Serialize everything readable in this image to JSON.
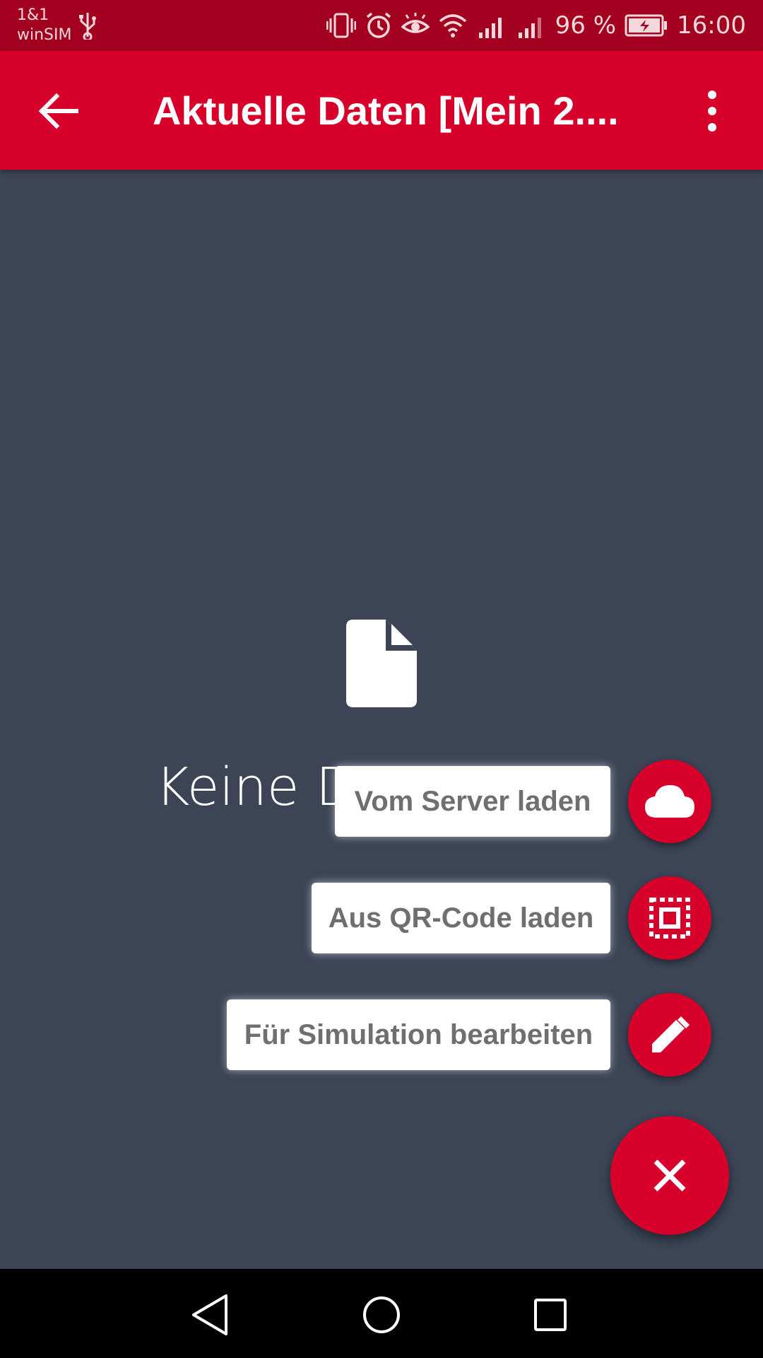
{
  "status_bar": {
    "carrier_line1": "1&1",
    "carrier_line2": "winSIM",
    "battery": "96 %",
    "time": "16:00",
    "icons": [
      "usb-icon",
      "vibrate-icon",
      "alarm-icon",
      "eye-icon",
      "wifi-icon",
      "signal-icon",
      "signal-icon-2",
      "battery-charging-icon"
    ]
  },
  "app_bar": {
    "title": "Aktuelle Daten [Mein 2....",
    "back_icon": "arrow-back-icon",
    "menu_icon": "more-vert-icon",
    "color": "#d6002a"
  },
  "empty_state": {
    "icon": "file-icon",
    "text": "Keine Daten"
  },
  "speed_dial": {
    "actions": [
      {
        "label": "Vom Server laden",
        "icon": "cloud-icon"
      },
      {
        "label": "Aus QR-Code laden",
        "icon": "qr-scan-icon"
      },
      {
        "label": "Für Simulation bearbeiten",
        "icon": "pencil-icon"
      }
    ],
    "close_icon": "close-icon"
  },
  "nav_bar": {
    "icons": [
      "nav-back-icon",
      "nav-home-icon",
      "nav-recents-icon"
    ]
  },
  "colors": {
    "accent": "#d6002a",
    "status_bar": "#a3001f",
    "background": "#3c4456"
  }
}
